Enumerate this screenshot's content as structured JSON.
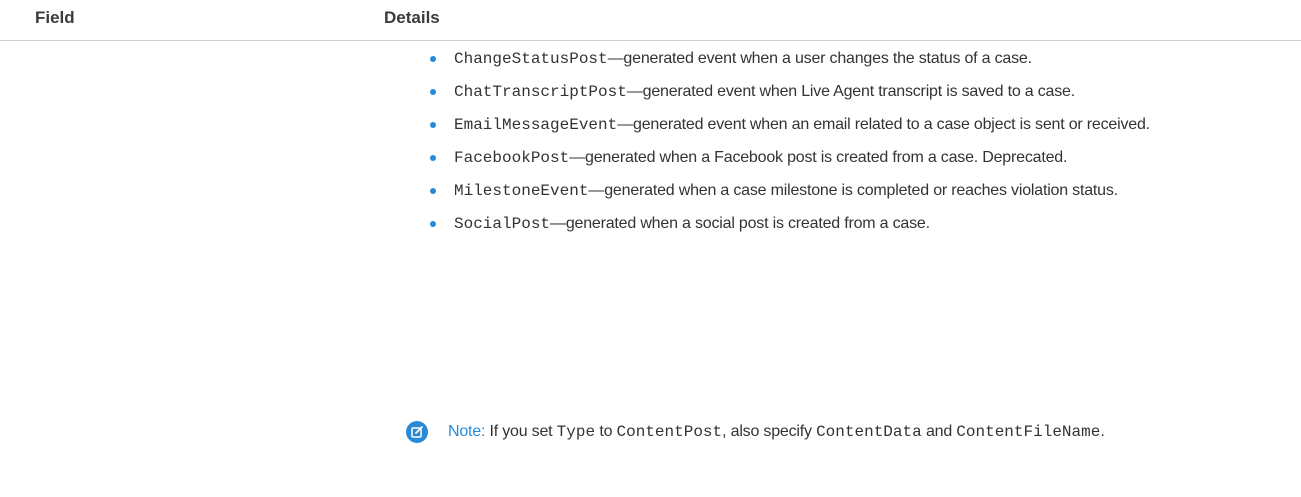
{
  "table": {
    "header": {
      "field": "Field",
      "details": "Details"
    }
  },
  "events": [
    {
      "code": "ChangeStatusPost",
      "text": "—generated event when a user changes the status of a case."
    },
    {
      "code": "ChatTranscriptPost",
      "text": "—generated event when Live Agent transcript is saved to a case."
    },
    {
      "code": "EmailMessageEvent",
      "text": "—generated event when an email related to a case object is sent or received."
    },
    {
      "code": "FacebookPost",
      "text": "—generated when a Facebook post is created from a case. Deprecated."
    },
    {
      "code": "MilestoneEvent",
      "text": "—generated when a case milestone is completed or reaches violation status."
    },
    {
      "code": "SocialPost",
      "text": "—generated when a social post is created from a case."
    }
  ],
  "note": {
    "label": "Note:",
    "text1": " If you set ",
    "code1": "Type",
    "text2": " to ",
    "code2": "ContentPost",
    "text3": ", also specify ",
    "code3": "ContentData",
    "text4": " and ",
    "code4": "ContentFileName",
    "text5": ".",
    "icon": "edit-note-icon",
    "accent_color": "#2a8ad6"
  }
}
